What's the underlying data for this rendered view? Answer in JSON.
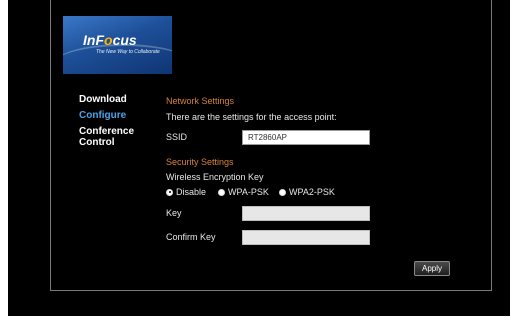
{
  "logo": {
    "brand_prefix": "InF",
    "brand_oo": "o",
    "brand_suffix": "cus",
    "tagline": "The New Way to Collaborate"
  },
  "nav": {
    "items": [
      {
        "label": "Download",
        "active": false
      },
      {
        "label": "Configure",
        "active": true
      },
      {
        "label": "Conference Control",
        "active": false
      }
    ]
  },
  "network": {
    "title": "Network Settings",
    "description": "There are the settings for the access point:",
    "ssid_label": "SSID",
    "ssid_value": "RT2860AP"
  },
  "security": {
    "title": "Security Settings",
    "encryption_label": "Wireless Encryption Key",
    "options": [
      {
        "label": "Disable",
        "selected": true
      },
      {
        "label": "WPA-PSK",
        "selected": false
      },
      {
        "label": "WPA2-PSK",
        "selected": false
      }
    ],
    "key_label": "Key",
    "key_value": "",
    "confirm_label": "Confirm Key",
    "confirm_value": ""
  },
  "apply_label": "Apply",
  "colors": {
    "accent_orange": "#d8823a",
    "nav_active": "#4aa3e8",
    "background": "#000000"
  }
}
